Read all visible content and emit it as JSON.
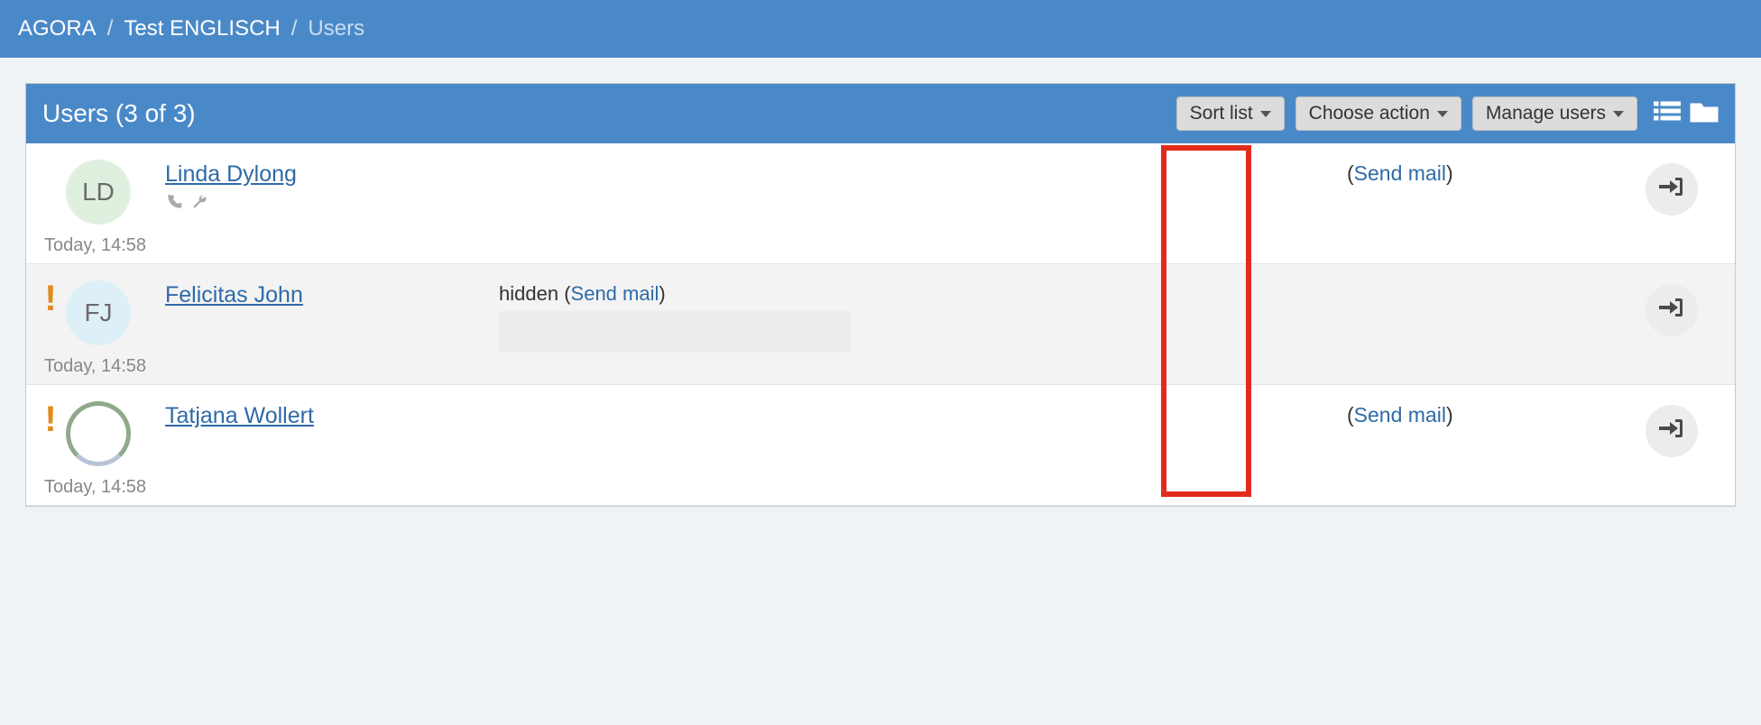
{
  "breadcrumb": {
    "root": "AGORA",
    "project": "Test ENGLISCH",
    "current": "Users"
  },
  "panel": {
    "title": "Users (3 of 3)"
  },
  "toolbar": {
    "sort_label": "Sort list",
    "choose_action_label": "Choose action",
    "manage_users_label": "Manage users"
  },
  "mail": {
    "link_text": "Send mail",
    "hidden_prefix": "hidden"
  },
  "users": [
    {
      "name": "Linda Dylong",
      "initials": "LD",
      "avatar_style": "green",
      "timestamp": "Today, 14:58",
      "has_warning": false,
      "has_role_icons": true,
      "email_hidden": false
    },
    {
      "name": "Felicitas John",
      "initials": "FJ",
      "avatar_style": "blue",
      "timestamp": "Today, 14:58",
      "has_warning": true,
      "has_role_icons": false,
      "email_hidden": true
    },
    {
      "name": "Tatjana Wollert",
      "initials": "",
      "avatar_style": "ring",
      "timestamp": "Today, 14:58",
      "has_warning": true,
      "has_role_icons": false,
      "email_hidden": false
    }
  ]
}
